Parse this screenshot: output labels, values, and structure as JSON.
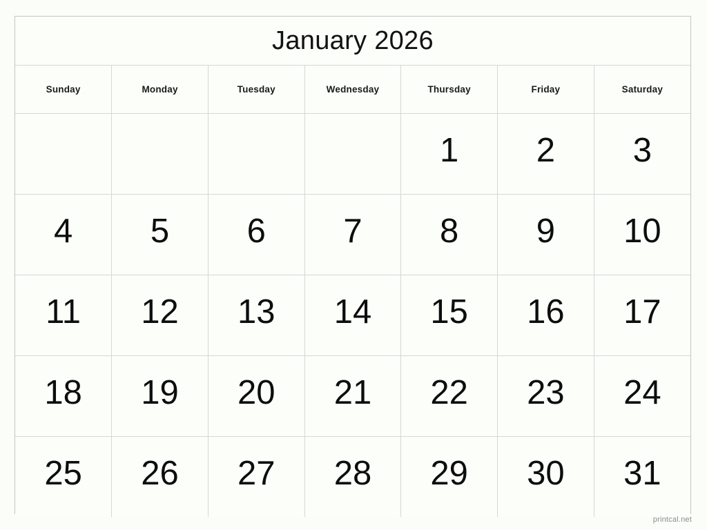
{
  "calendar": {
    "title": "January 2026",
    "month": "January",
    "year": "2026",
    "weekdays": [
      "Sunday",
      "Monday",
      "Tuesday",
      "Wednesday",
      "Thursday",
      "Friday",
      "Saturday"
    ],
    "weeks": [
      [
        "",
        "",
        "",
        "",
        "1",
        "2",
        "3"
      ],
      [
        "4",
        "5",
        "6",
        "7",
        "8",
        "9",
        "10"
      ],
      [
        "11",
        "12",
        "13",
        "14",
        "15",
        "16",
        "17"
      ],
      [
        "18",
        "19",
        "20",
        "21",
        "22",
        "23",
        "24"
      ],
      [
        "25",
        "26",
        "27",
        "28",
        "29",
        "30",
        "31"
      ]
    ]
  },
  "footer": {
    "credit": "printcal.net"
  },
  "colors": {
    "page_background": "#fbfdf8",
    "cell_background": "#fcfefa",
    "grid_line": "#d4d8d2",
    "frame_border": "#c3c7c0",
    "title_text": "#121212",
    "weekday_text": "#1a1a1a",
    "date_text": "#0d0d0d",
    "footer_text": "#8b8b8b"
  }
}
